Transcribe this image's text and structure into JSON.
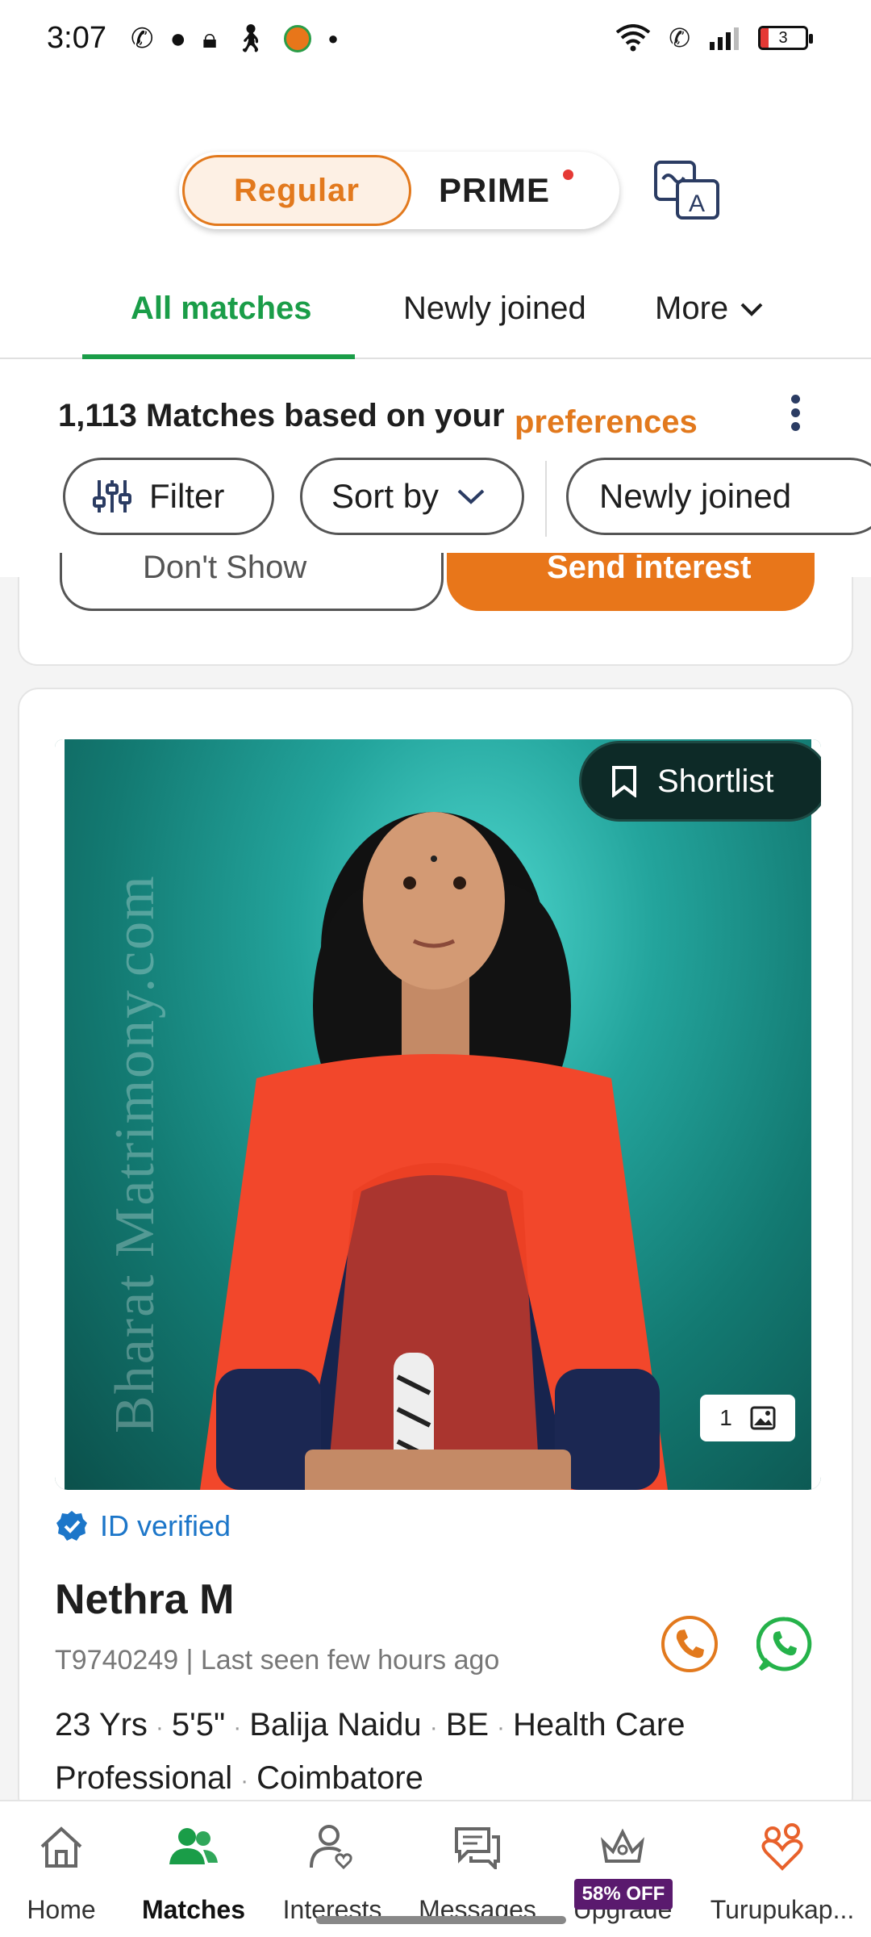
{
  "status_bar": {
    "time": "3:07",
    "battery": "3",
    "left_icons": [
      "wifi-call-icon",
      "chat-bubble-icon",
      "lock-icon",
      "walking-icon",
      "app-icon",
      "dot-icon"
    ],
    "right_icons": [
      "wifi-icon",
      "volte-icon",
      "signal-icon",
      "battery-icon"
    ]
  },
  "plan_toggle": {
    "regular": "Regular",
    "prime": "PRIME"
  },
  "tabs": {
    "all": "All matches",
    "new": "Newly joined",
    "more": "More"
  },
  "match_bar": {
    "count_text": "1,113 Matches based on your",
    "pref_text": "preferences"
  },
  "chips": {
    "filter": "Filter",
    "sort": "Sort by",
    "newly": "Newly joined"
  },
  "prev_card": {
    "dont_show": "Don't Show",
    "send_interest": "Send interest"
  },
  "profile": {
    "watermark": "Bharat Matrimony.com",
    "shortlist": "Shortlist",
    "photo_count": "1",
    "verified": "ID verified",
    "name": "Nethra M",
    "id_line": "T9740249 | Last seen few hours ago",
    "age": "23 Yrs",
    "height": "5'5\"",
    "caste": "Balija Naidu",
    "education": "BE",
    "profession": "Health Care Professional",
    "location": "Coimbatore"
  },
  "nav": {
    "home": "Home",
    "matches": "Matches",
    "interests": "Interests",
    "messages": "Messages",
    "upgrade": "Upgrade",
    "upgrade_badge": "58% OFF",
    "turupu": "Turupukap..."
  },
  "colors": {
    "accent_green": "#1a9d48",
    "accent_orange": "#e2791d",
    "verified_blue": "#1c76c9",
    "badge_purple": "#5a1a6e"
  }
}
